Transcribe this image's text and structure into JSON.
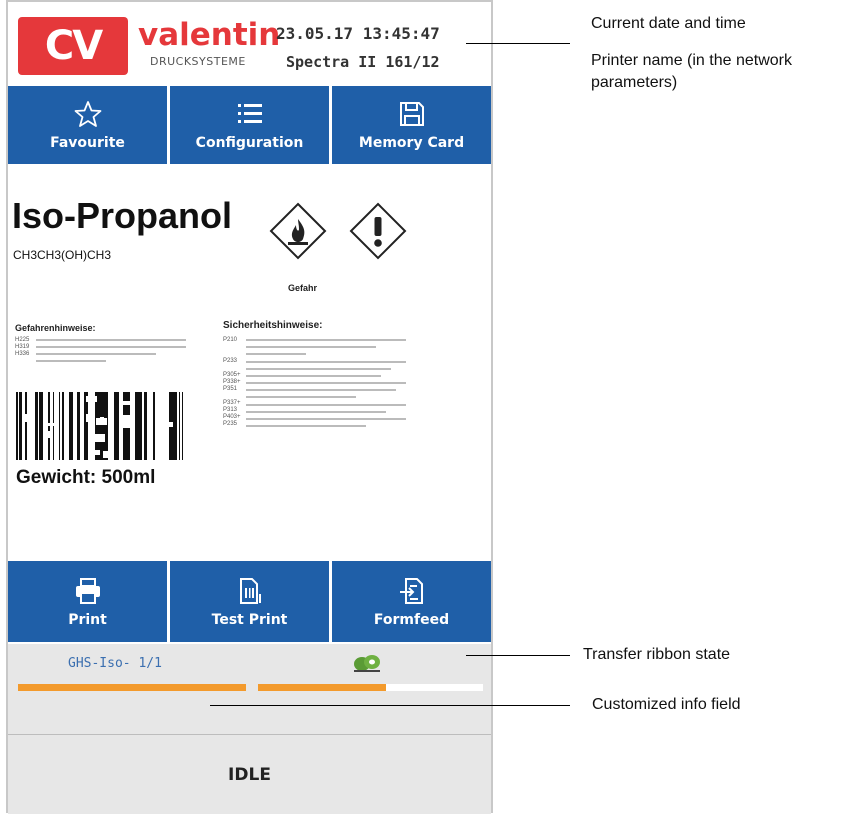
{
  "header": {
    "logo_text": "CV",
    "brand": "valentin",
    "brand_sub": "DRUCKSYSTEME",
    "datetime": "23.05.17  13:45:47",
    "printer": "Spectra II 161/12"
  },
  "top_buttons": [
    {
      "label": "Favourite",
      "icon": "star-icon"
    },
    {
      "label": "Configuration",
      "icon": "list-icon"
    },
    {
      "label": "Memory Card",
      "icon": "floppy-icon"
    }
  ],
  "label_preview": {
    "name": "Iso-Propanol",
    "formula": "CH3CH3(OH)CH3",
    "signal_word": "Gefahr",
    "hazard_title": "Gefahrenhinweise:",
    "precaution_title": "Sicherheitshinweise:",
    "hazard_codes": [
      "H225",
      "H319",
      "H336"
    ],
    "precaution_codes": [
      "P210",
      "P233",
      "P305+",
      "P338+",
      "P351",
      "P337+",
      "P313",
      "P403+",
      "P235"
    ],
    "weight": "Gewicht:  500ml"
  },
  "bottom_buttons": [
    {
      "label": "Print",
      "icon": "printer-icon"
    },
    {
      "label": "Test Print",
      "icon": "test-print-icon"
    },
    {
      "label": "Formfeed",
      "icon": "formfeed-icon"
    }
  ],
  "status": {
    "job": "GHS-Iso-  1/1",
    "job_progress": 1.0,
    "ribbon_progress": 0.57,
    "state": "IDLE"
  },
  "callouts": {
    "datetime": "Current date and time",
    "printer": "Printer name (in the network parameters)",
    "ribbon": "Transfer ribbon state",
    "info": "Customized info field"
  },
  "colors": {
    "button_blue": "#1f5fa8",
    "brand_red": "#e5383b",
    "progress_orange": "#f39a2c",
    "status_gray": "#e7e7e7"
  }
}
